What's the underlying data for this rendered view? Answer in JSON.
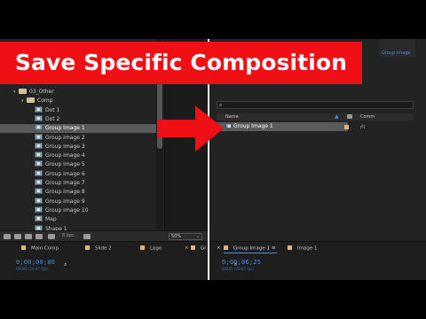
{
  "title": "Save Specific Composition",
  "left_panel": {
    "items": [
      {
        "label": "03_Other",
        "type": "folder",
        "indent": 1,
        "twirl": "▾"
      },
      {
        "label": "Comp",
        "type": "folder",
        "indent": 2,
        "twirl": "▾"
      },
      {
        "label": "Dot 1",
        "type": "comp",
        "indent": 3
      },
      {
        "label": "Dot 2",
        "type": "comp",
        "indent": 3
      },
      {
        "label": "Group Image 1",
        "type": "comp",
        "indent": 3,
        "selected": true
      },
      {
        "label": "Group Image 2",
        "type": "comp",
        "indent": 3
      },
      {
        "label": "Group Image 3",
        "type": "comp",
        "indent": 3
      },
      {
        "label": "Group Image 4",
        "type": "comp",
        "indent": 3
      },
      {
        "label": "Group Image 5",
        "type": "comp",
        "indent": 3
      },
      {
        "label": "Group Image 6",
        "type": "comp",
        "indent": 3
      },
      {
        "label": "Group Image 7",
        "type": "comp",
        "indent": 3
      },
      {
        "label": "Group Image 8",
        "type": "comp",
        "indent": 3
      },
      {
        "label": "Group Image 9",
        "type": "comp",
        "indent": 3
      },
      {
        "label": "Group Image 10",
        "type": "comp",
        "indent": 3
      },
      {
        "label": "Map",
        "type": "comp",
        "indent": 3
      },
      {
        "label": "Shape 1",
        "type": "comp",
        "indent": 3
      }
    ],
    "bpc": "8 bpc"
  },
  "viewer": {
    "zoom": "50%",
    "zoom_arrow": "⌄"
  },
  "right_panel": {
    "top_tab": "Group Image",
    "header": {
      "name": "Name",
      "sort_icon": "▲",
      "comment": "Comm"
    },
    "row": {
      "label": "Group Image 1",
      "share_icon": "⛙"
    }
  },
  "timeline": {
    "left": {
      "tabs": [
        "Main Comp",
        "Slide 2",
        "Logo"
      ],
      "close_glyph": "×",
      "extra_tab": "Gr",
      "timecode": "0;00;00;00",
      "fps": "00000 (29.97 fps)"
    },
    "right": {
      "tabs": [
        "Group Image 1",
        "Image 1"
      ],
      "close_glyph": "×",
      "menu_glyph": "≡",
      "timecode": "0;00;06;25",
      "fps": "00205 (29.97 fps)"
    }
  },
  "search_glyph": "⌕",
  "colors": {
    "banner": "#f10f16",
    "accent": "#4a8fd8",
    "label_tan": "#e2b17d"
  }
}
